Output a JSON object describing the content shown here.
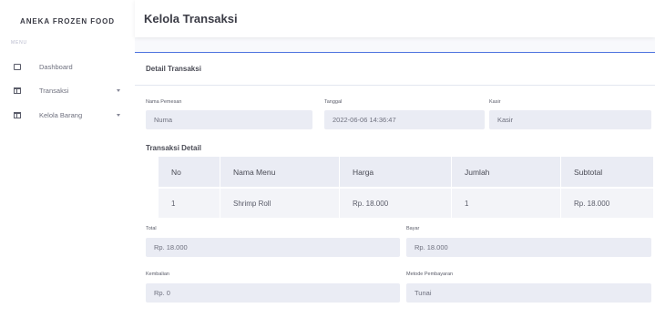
{
  "sidebar": {
    "brand": "ANEKA FROZEN FOOD",
    "menu_heading": "MENU",
    "items": [
      {
        "label": "Dashboard",
        "icon": "square-icon",
        "has_caret": false
      },
      {
        "label": "Transaksi",
        "icon": "table-icon",
        "has_caret": true
      },
      {
        "label": "Kelola Barang",
        "icon": "table-icon",
        "has_caret": true
      }
    ]
  },
  "header": {
    "title": "Kelola Transaksi"
  },
  "card": {
    "title": "Detail Transaksi",
    "fields": {
      "nama_pemesan": {
        "label": "Nama Pemesan",
        "value": "Numa"
      },
      "tanggal": {
        "label": "Tanggal",
        "value": "2022-06-06 14:36:47"
      },
      "kasir": {
        "label": "Kasir",
        "value": "Kasir"
      },
      "total": {
        "label": "Total",
        "value": "Rp. 18.000"
      },
      "bayar": {
        "label": "Bayar",
        "value": "Rp. 18.000"
      },
      "kembalian": {
        "label": "Kembalian",
        "value": "Rp. 0"
      },
      "metode": {
        "label": "Metode Pembayaran",
        "value": "Tunai"
      }
    },
    "detail_section_title": "Transaksi Detail",
    "table": {
      "columns": [
        "No",
        "Nama Menu",
        "Harga",
        "Jumlah",
        "Subtotal"
      ],
      "rows": [
        [
          "1",
          "Shrimp Roll",
          "Rp. 18.000",
          "1",
          "Rp. 18.000"
        ]
      ]
    }
  },
  "colors": {
    "accent": "#4e73df",
    "field_bg": "#eaecf4",
    "page_bg": "#f8f9fc"
  }
}
